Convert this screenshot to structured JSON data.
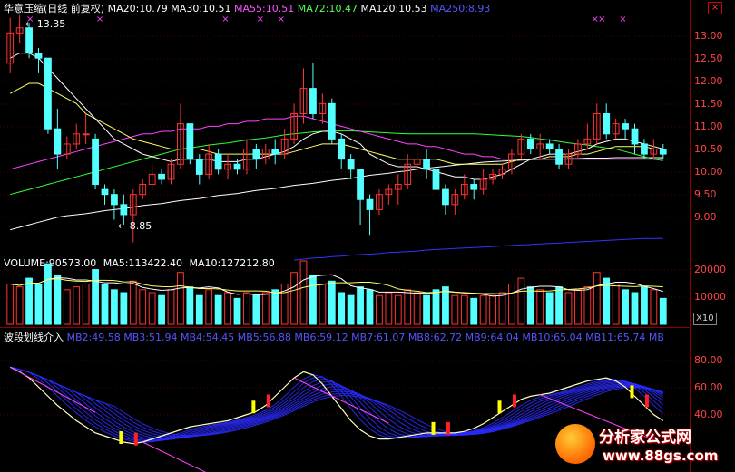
{
  "header": {
    "title": "华意压缩(日线 前复权)",
    "ma": [
      {
        "label": "MA20:10.79",
        "color": "#ffffff"
      },
      {
        "label": "MA30:10.51",
        "color": "#ffffff"
      },
      {
        "label": "MA55:10.51",
        "color": "#ff55ff"
      },
      {
        "label": "MA72:10.47",
        "color": "#55ff55"
      },
      {
        "label": "MA120:10.53",
        "color": "#ffffff"
      },
      {
        "label": "MA250:8.93",
        "color": "#5555ff"
      }
    ]
  },
  "price_axis": [
    "13.00",
    "12.50",
    "12.00",
    "11.50",
    "11.00",
    "10.50",
    "10.00",
    "9.50",
    "9.00"
  ],
  "price_high": "13.35",
  "price_low": "8.85",
  "volume": {
    "title": "VOLUME:90573.00",
    "ma5": "MA5:113422.40",
    "ma10": "MA10:127212.80",
    "axis": [
      "20000",
      "10000"
    ],
    "unit": "X10"
  },
  "indicator": {
    "title": "波段划线介入",
    "mb": [
      "MB2:49.58",
      "MB3:51.94",
      "MB4:54.45",
      "MB5:56.88",
      "MB6:59.12",
      "MB7:61.07",
      "MB8:62.72",
      "MB9:64.04",
      "MB10:65.04",
      "MB11:65.74",
      "MB"
    ],
    "axis": [
      "80.00",
      "60.00",
      "40.00"
    ]
  },
  "watermark": {
    "text": "分析家公式网",
    "url": "www.88gs.com"
  },
  "close_label": "×",
  "chart_data": {
    "type": "candlestick",
    "y_range": [
      8.7,
      13.4
    ],
    "candles": [
      [
        12.4,
        13.0,
        13.3,
        12.2
      ],
      [
        13.0,
        13.1,
        13.35,
        12.8
      ],
      [
        13.1,
        12.6,
        13.2,
        12.5
      ],
      [
        12.6,
        12.5,
        12.7,
        12.2
      ],
      [
        12.5,
        11.1,
        12.5,
        11.0
      ],
      [
        11.1,
        10.6,
        11.5,
        10.3
      ],
      [
        10.6,
        10.8,
        10.95,
        10.5
      ],
      [
        10.8,
        11.0,
        11.2,
        10.7
      ],
      [
        11.0,
        11.0,
        11.4,
        10.8
      ],
      [
        10.9,
        10.0,
        11.0,
        9.9
      ],
      [
        9.9,
        9.8,
        10.0,
        9.6
      ],
      [
        9.8,
        9.6,
        9.9,
        9.3
      ],
      [
        9.6,
        9.4,
        9.8,
        9.2
      ],
      [
        9.4,
        9.8,
        9.9,
        8.85
      ],
      [
        9.8,
        10.0,
        10.1,
        9.7
      ],
      [
        10.0,
        10.2,
        10.4,
        9.9
      ],
      [
        10.2,
        10.1,
        10.3,
        10.0
      ],
      [
        10.1,
        10.4,
        10.5,
        10.0
      ],
      [
        10.4,
        11.2,
        11.6,
        10.3
      ],
      [
        11.2,
        10.5,
        11.2,
        10.4
      ],
      [
        10.5,
        10.2,
        10.6,
        10.0
      ],
      [
        10.2,
        10.6,
        10.8,
        10.1
      ],
      [
        10.6,
        10.3,
        10.7,
        10.2
      ],
      [
        10.3,
        10.4,
        10.6,
        10.1
      ],
      [
        10.4,
        10.3,
        10.5,
        10.2
      ],
      [
        10.3,
        10.7,
        10.9,
        10.2
      ],
      [
        10.7,
        10.5,
        10.8,
        10.3
      ],
      [
        10.5,
        10.7,
        10.8,
        10.4
      ],
      [
        10.7,
        10.6,
        10.9,
        10.4
      ],
      [
        10.6,
        10.9,
        11.1,
        10.5
      ],
      [
        10.9,
        11.4,
        11.6,
        10.8
      ],
      [
        11.4,
        11.9,
        12.3,
        11.2
      ],
      [
        11.9,
        11.4,
        12.4,
        11.3
      ],
      [
        11.4,
        11.6,
        11.8,
        11.2
      ],
      [
        11.6,
        10.9,
        11.7,
        10.8
      ],
      [
        10.9,
        10.5,
        11.0,
        10.3
      ],
      [
        10.5,
        10.3,
        10.6,
        10.1
      ],
      [
        10.3,
        9.7,
        10.3,
        9.2
      ],
      [
        9.7,
        9.5,
        9.8,
        9.0
      ],
      [
        9.5,
        9.8,
        9.9,
        9.4
      ],
      [
        9.8,
        9.9,
        10.0,
        9.6
      ],
      [
        9.9,
        10.0,
        10.2,
        9.6
      ],
      [
        10.0,
        10.4,
        10.6,
        9.9
      ],
      [
        10.4,
        10.5,
        10.7,
        10.3
      ],
      [
        10.5,
        10.3,
        10.7,
        10.1
      ],
      [
        10.3,
        9.9,
        10.4,
        9.7
      ],
      [
        9.9,
        9.6,
        10.0,
        9.4
      ],
      [
        9.6,
        9.8,
        9.9,
        9.4
      ],
      [
        9.8,
        10.0,
        10.2,
        9.7
      ],
      [
        10.0,
        9.9,
        10.1,
        9.7
      ],
      [
        9.9,
        10.1,
        10.3,
        9.8
      ],
      [
        10.1,
        10.2,
        10.3,
        10.0
      ],
      [
        10.2,
        10.3,
        10.4,
        10.1
      ],
      [
        10.3,
        10.6,
        10.7,
        10.2
      ],
      [
        10.6,
        10.9,
        11.0,
        10.5
      ],
      [
        10.9,
        10.7,
        11.0,
        10.6
      ],
      [
        10.7,
        10.8,
        11.0,
        10.5
      ],
      [
        10.8,
        10.7,
        10.9,
        10.6
      ],
      [
        10.7,
        10.4,
        10.8,
        10.3
      ],
      [
        10.4,
        10.6,
        10.7,
        10.3
      ],
      [
        10.6,
        10.8,
        10.9,
        10.5
      ],
      [
        10.8,
        10.9,
        11.2,
        10.7
      ],
      [
        10.9,
        11.4,
        11.6,
        10.8
      ],
      [
        11.4,
        11.0,
        11.6,
        10.9
      ],
      [
        11.0,
        11.2,
        11.3,
        10.9
      ],
      [
        11.2,
        11.1,
        11.3,
        10.9
      ],
      [
        11.1,
        10.8,
        11.2,
        10.6
      ],
      [
        10.8,
        10.6,
        10.9,
        10.5
      ],
      [
        10.6,
        10.7,
        10.9,
        10.5
      ],
      [
        10.7,
        10.6,
        10.8,
        10.5
      ]
    ],
    "volume": [
      14,
      13,
      16,
      14,
      21,
      17,
      12,
      13,
      14,
      19,
      14,
      12,
      11,
      15,
      12,
      11,
      10,
      12,
      18,
      13,
      10,
      12,
      10,
      11,
      9,
      11,
      10,
      11,
      12,
      14,
      18,
      22,
      17,
      14,
      15,
      11,
      10,
      13,
      12,
      10,
      11,
      10,
      12,
      11,
      10,
      12,
      13,
      10,
      10,
      9,
      10,
      10,
      11,
      14,
      16,
      13,
      12,
      11,
      13,
      11,
      12,
      13,
      18,
      16,
      14,
      12,
      11,
      13,
      12,
      9
    ],
    "ma_series": {
      "ma_white": [
        12.5,
        12.6,
        12.6,
        12.5,
        12.3,
        12.1,
        11.9,
        11.7,
        11.5,
        11.3,
        11.1,
        10.9,
        10.8,
        10.7,
        10.6,
        10.55,
        10.5,
        10.45,
        10.5,
        10.5,
        10.5,
        10.5,
        10.45,
        10.45,
        10.45,
        10.5,
        10.5,
        10.55,
        10.6,
        10.65,
        10.75,
        10.9,
        11.0,
        11.05,
        11.05,
        11.0,
        10.9,
        10.8,
        10.6,
        10.5,
        10.4,
        10.35,
        10.35,
        10.35,
        10.3,
        10.25,
        10.2,
        10.15,
        10.15,
        10.1,
        10.1,
        10.15,
        10.2,
        10.3,
        10.4,
        10.5,
        10.55,
        10.6,
        10.6,
        10.6,
        10.65,
        10.7,
        10.8,
        10.85,
        10.9,
        10.9,
        10.85,
        10.8,
        10.75,
        10.7
      ],
      "ma_yellow": [
        11.8,
        11.9,
        12.0,
        12.0,
        11.9,
        11.8,
        11.7,
        11.6,
        11.4,
        11.3,
        11.2,
        11.1,
        11.0,
        10.9,
        10.85,
        10.8,
        10.75,
        10.7,
        10.7,
        10.7,
        10.7,
        10.65,
        10.6,
        10.6,
        10.6,
        10.6,
        10.6,
        10.6,
        10.6,
        10.6,
        10.65,
        10.7,
        10.75,
        10.8,
        10.8,
        10.8,
        10.75,
        10.7,
        10.65,
        10.6,
        10.55,
        10.5,
        10.5,
        10.5,
        10.5,
        10.5,
        10.45,
        10.4,
        10.4,
        10.4,
        10.4,
        10.4,
        10.4,
        10.45,
        10.5,
        10.5,
        10.5,
        10.55,
        10.55,
        10.55,
        10.6,
        10.6,
        10.65,
        10.7,
        10.75,
        10.75,
        10.75,
        10.75,
        10.7,
        10.7
      ],
      "ma55": [
        10.3,
        10.35,
        10.4,
        10.45,
        10.5,
        10.55,
        10.6,
        10.65,
        10.7,
        10.75,
        10.8,
        10.85,
        10.9,
        10.95,
        11.0,
        11.0,
        11.05,
        11.05,
        11.1,
        11.1,
        11.1,
        11.15,
        11.15,
        11.2,
        11.2,
        11.25,
        11.25,
        11.3,
        11.3,
        11.3,
        11.35,
        11.35,
        11.3,
        11.25,
        11.2,
        11.15,
        11.1,
        11.05,
        11.0,
        10.95,
        10.9,
        10.85,
        10.8,
        10.8,
        10.75,
        10.75,
        10.7,
        10.65,
        10.6,
        10.6,
        10.55,
        10.55,
        10.5,
        10.5,
        10.5,
        10.5,
        10.5,
        10.5,
        10.5,
        10.5,
        10.5,
        10.5,
        10.5,
        10.5,
        10.5,
        10.5,
        10.5,
        10.5,
        10.5,
        10.51
      ],
      "ma72": [
        9.8,
        9.85,
        9.9,
        9.95,
        10.0,
        10.05,
        10.1,
        10.15,
        10.2,
        10.25,
        10.3,
        10.35,
        10.4,
        10.45,
        10.5,
        10.55,
        10.6,
        10.65,
        10.7,
        10.72,
        10.75,
        10.78,
        10.8,
        10.82,
        10.85,
        10.88,
        10.9,
        10.92,
        10.95,
        10.98,
        11.0,
        11.02,
        11.04,
        11.05,
        11.06,
        11.06,
        11.06,
        11.05,
        11.04,
        11.03,
        11.02,
        11.01,
        11.0,
        11.0,
        11.0,
        11.0,
        11.0,
        11.0,
        11.0,
        11.0,
        10.99,
        10.98,
        10.97,
        10.96,
        10.95,
        10.93,
        10.9,
        10.88,
        10.85,
        10.82,
        10.8,
        10.78,
        10.75,
        10.72,
        10.7,
        10.65,
        10.6,
        10.55,
        10.5,
        10.47
      ],
      "ma120": [
        9.1,
        9.15,
        9.2,
        9.25,
        9.3,
        9.35,
        9.38,
        9.4,
        9.42,
        9.45,
        9.48,
        9.5,
        9.52,
        9.55,
        9.58,
        9.6,
        9.62,
        9.65,
        9.68,
        9.7,
        9.72,
        9.75,
        9.78,
        9.8,
        9.82,
        9.85,
        9.88,
        9.9,
        9.92,
        9.95,
        9.98,
        10.0,
        10.02,
        10.05,
        10.08,
        10.1,
        10.12,
        10.15,
        10.18,
        10.2,
        10.22,
        10.25,
        10.27,
        10.3,
        10.32,
        10.34,
        10.36,
        10.38,
        10.4,
        10.42,
        10.44,
        10.45,
        10.46,
        10.47,
        10.48,
        10.49,
        10.5,
        10.5,
        10.5,
        10.51,
        10.51,
        10.52,
        10.52,
        10.52,
        10.53,
        10.53,
        10.53,
        10.53,
        10.53,
        10.53
      ],
      "ma250_start": 30,
      "ma250": [
        8.5,
        8.52,
        8.54,
        8.55,
        8.57,
        8.58,
        8.6,
        8.61,
        8.62,
        8.63,
        8.65,
        8.66,
        8.67,
        8.68,
        8.7,
        8.71,
        8.72,
        8.73,
        8.74,
        8.75,
        8.76,
        8.77,
        8.78,
        8.79,
        8.8,
        8.81,
        8.82,
        8.83,
        8.84,
        8.85,
        8.86,
        8.87,
        8.88,
        8.89,
        8.9,
        8.91,
        8.92,
        8.93,
        8.93,
        8.93
      ]
    },
    "indicator_curve": [
      85,
      82,
      78,
      72,
      66,
      60,
      55,
      50,
      46,
      42,
      40,
      38,
      36,
      35,
      36,
      38,
      40,
      42,
      44,
      46,
      47,
      48,
      49,
      50,
      52,
      54,
      56,
      60,
      66,
      72,
      78,
      82,
      80,
      74,
      66,
      58,
      50,
      44,
      40,
      38,
      38,
      39,
      40,
      41,
      42,
      42,
      42,
      42,
      43,
      45,
      48,
      52,
      56,
      60,
      64,
      66,
      67,
      68,
      70,
      72,
      74,
      76,
      77,
      78,
      76,
      72,
      66,
      60,
      54,
      50
    ],
    "signals": [
      {
        "i": 14,
        "y": "yellow"
      },
      {
        "i": 15,
        "y": "red"
      },
      {
        "i": 30,
        "y": "yellow"
      },
      {
        "i": 31,
        "y": "red"
      },
      {
        "i": 52,
        "y": "yellow"
      },
      {
        "i": 53,
        "y": "red"
      },
      {
        "i": 60,
        "y": "yellow"
      },
      {
        "i": 61,
        "y": "red"
      },
      {
        "i": 76,
        "y": "yellow"
      },
      {
        "i": 77,
        "y": "red"
      }
    ],
    "stars": [
      3,
      13,
      31,
      36,
      39,
      84,
      85,
      88
    ]
  }
}
